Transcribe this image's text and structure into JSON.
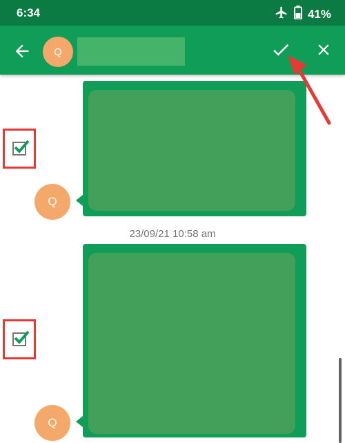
{
  "status_bar": {
    "time": "6:34",
    "battery": "41%",
    "icons": [
      "airplane-mode-icon",
      "battery-icon"
    ]
  },
  "header": {
    "avatar_initial": "Q",
    "icons": [
      "back-arrow-icon",
      "check-icon",
      "close-icon"
    ]
  },
  "messages": [
    {
      "avatar_initial": "Q",
      "selected": true
    },
    {
      "timestamp": "23/09/21 10:58 am",
      "avatar_initial": "Q",
      "selected": true
    }
  ],
  "colors": {
    "status_bar": "#0b7a43",
    "app_bar": "#0f9d58",
    "bubble": "#0f9d58",
    "bubble_inner": "#42a05a",
    "avatar": "#f4a86a",
    "highlight": "#e53935"
  }
}
